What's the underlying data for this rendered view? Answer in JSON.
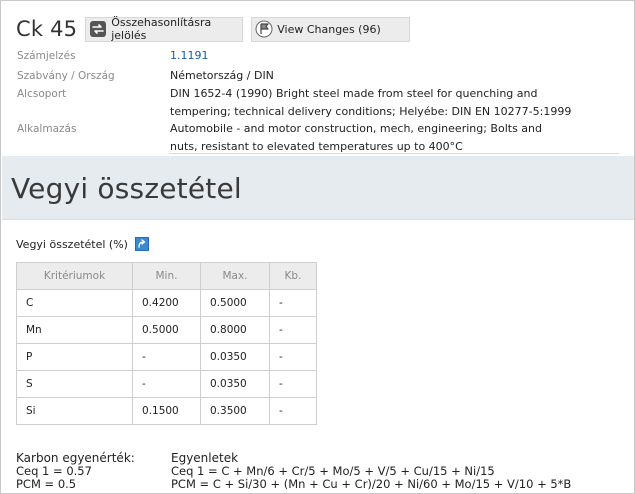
{
  "header": {
    "material": "Ck 45",
    "compare_label": "Összehasonlításra jelölés",
    "changes_label": "View Changes (96)"
  },
  "properties": [
    {
      "label": "Számjelzés",
      "value": "1.1191"
    },
    {
      "label": "Szabvány / Ország",
      "value": "Németország / DIN"
    },
    {
      "label": "Alcsoport",
      "value": "DIN 1652-4 (1990) Bright steel made from steel for quenching and tempering; technical delivery conditions; Helyébe: DIN EN 10277-5:1999"
    },
    {
      "label": "Alkalmazás",
      "value": "Automobile - and motor construction, mech, engineering; Bolts and nuts, resistant to elevated temperatures up to 400°C"
    }
  ],
  "section": {
    "title": "Vegyi összetétel"
  },
  "composition": {
    "subtitle": "Vegyi összetétel (%)",
    "columns": [
      "Kritériumok",
      "Min.",
      "Max.",
      "Kb."
    ],
    "rows": [
      [
        "C",
        "0.4200",
        "0.5000",
        "-"
      ],
      [
        "Mn",
        "0.5000",
        "0.8000",
        "-"
      ],
      [
        "P",
        "-",
        "0.0350",
        "-"
      ],
      [
        "S",
        "-",
        "0.0350",
        "-"
      ],
      [
        "Si",
        "0.1500",
        "0.3500",
        "-"
      ]
    ]
  },
  "carbon": {
    "heading": "Karbon egyenérték:",
    "ceq": "Ceq 1 = 0.57",
    "pcm": "PCM = 0.5"
  },
  "equations": {
    "heading": "Egyenletek",
    "ceq": "Ceq 1 = C + Mn/6 + Cr/5 + Mo/5 + V/5 + Cu/15 + Ni/15",
    "pcm": "PCM = C + Si/30 + (Mn + Cu + Cr)/20 + Ni/60 + Mo/15 + V/10 + 5*B"
  }
}
